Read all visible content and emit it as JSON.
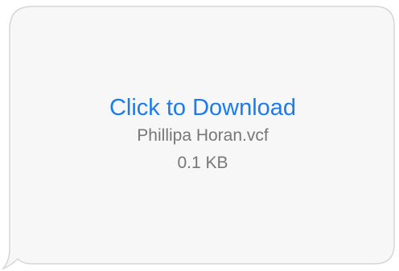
{
  "message": {
    "download_label": "Click to Download",
    "file_name": "Phillipa Horan.vcf",
    "file_size": "0.1 KB"
  },
  "colors": {
    "link": "#1a7cf0",
    "meta_text": "#777777",
    "bubble_fill": "#f7f7f7",
    "bubble_border": "#d6d6d6"
  }
}
